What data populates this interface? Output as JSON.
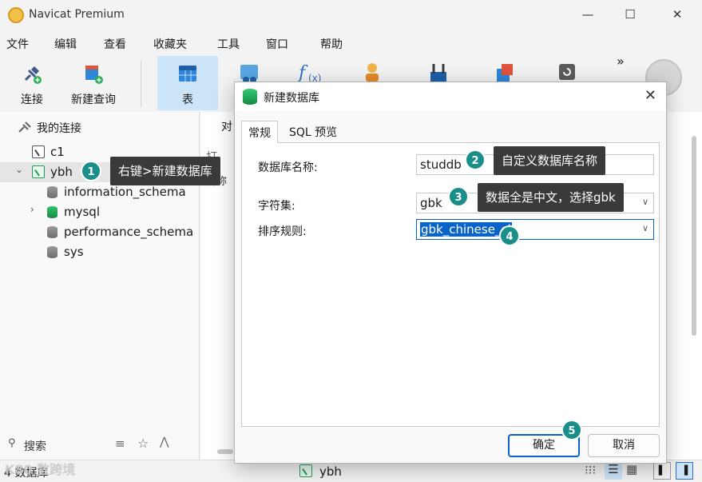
{
  "window": {
    "title": "Navicat Premium",
    "minimize": "—",
    "maximize": "☐",
    "close": "✕"
  },
  "menu": [
    "文件",
    "编辑",
    "查看",
    "收藏夹",
    "工具",
    "窗口",
    "帮助"
  ],
  "toolbar": {
    "connect": "连接",
    "new_query": "新建查询",
    "table": "表",
    "more": "»"
  },
  "sidebar": {
    "header": "我的连接",
    "connections": [
      {
        "label": "c1"
      },
      {
        "label": "ybh"
      }
    ],
    "databases": [
      "information_schema",
      "mysql",
      "performance_schema",
      "sys"
    ],
    "search_placeholder": "搜索"
  },
  "background": {
    "tab_fragment": "对",
    "open_fragment": "打",
    "name_fragment": "名称"
  },
  "status": {
    "count": "4 数据库",
    "connection": "ybh"
  },
  "dialog": {
    "title": "新建数据库",
    "tabs": [
      "常规",
      "SQL 预览"
    ],
    "fields": {
      "name_label": "数据库名称:",
      "name_value": "studdb",
      "charset_label": "字符集:",
      "charset_value": "gbk",
      "collation_label": "排序规则:",
      "collation_value": "gbk_chinese_ci"
    },
    "ok": "确定",
    "cancel": "取消"
  },
  "annotations": [
    {
      "num": "1",
      "text": "右键>新建数据库"
    },
    {
      "num": "2",
      "text": "自定义数据库名称"
    },
    {
      "num": "3",
      "text": "数据全是中文，选择gbk"
    },
    {
      "num": "4",
      "text": ""
    },
    {
      "num": "5",
      "text": ""
    }
  ],
  "watermark": "K80 数跨境",
  "colors": {
    "accent": "#0a64c8",
    "badge": "#1a8f8a",
    "tooltip": "#3a3a3a",
    "db_green": "#1e9f52"
  }
}
